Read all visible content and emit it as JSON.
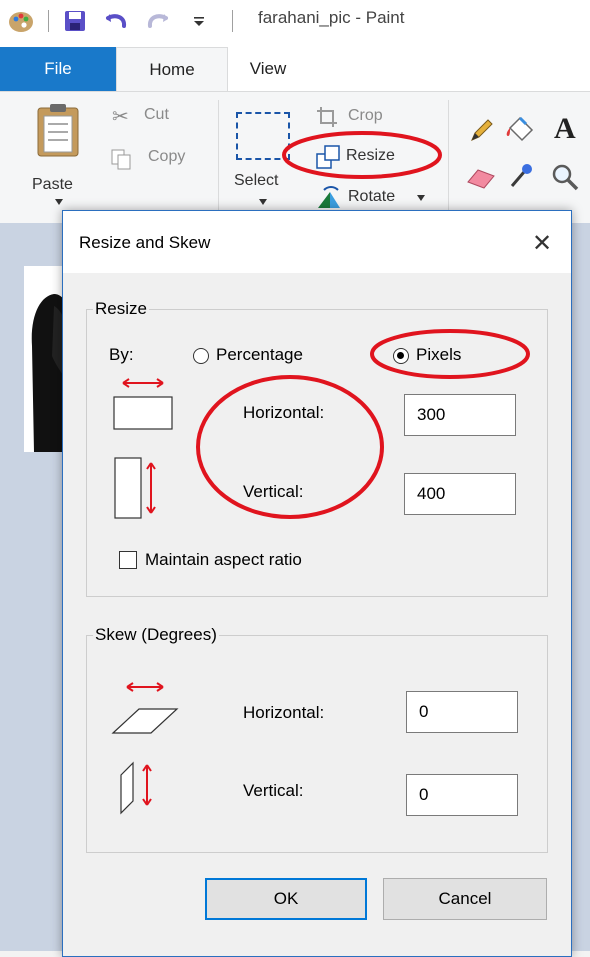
{
  "window": {
    "title": "farahani_pic - Paint"
  },
  "tabs": [
    {
      "label": "File",
      "active": false
    },
    {
      "label": "Home",
      "active": true
    },
    {
      "label": "View",
      "active": false
    }
  ],
  "ribbon": {
    "clipboard": {
      "paste": "Paste",
      "cut": "Cut",
      "copy": "Copy"
    },
    "image": {
      "select": "Select",
      "crop": "Crop",
      "resize": "Resize",
      "rotate": "Rotate"
    },
    "tools": {
      "text_glyph": "A"
    }
  },
  "dialog": {
    "title": "Resize and Skew",
    "close_glyph": "✕",
    "resize": {
      "legend": "Resize",
      "by_label": "By:",
      "options": [
        "Percentage",
        "Pixels"
      ],
      "selected": "Pixels",
      "horizontal_label": "Horizontal:",
      "horizontal_value": "300",
      "vertical_label": "Vertical:",
      "vertical_value": "400",
      "maintain_label": "Maintain aspect ratio",
      "maintain_checked": false
    },
    "skew": {
      "legend": "Skew (Degrees)",
      "horizontal_label": "Horizontal:",
      "horizontal_value": "0",
      "vertical_label": "Vertical:",
      "vertical_value": "0"
    },
    "ok": "OK",
    "cancel": "Cancel"
  },
  "colors": {
    "file_tab": "#1979ca",
    "annotation_red": "#e0141e",
    "icon_arrow_red": "#e0141e",
    "canvas_bg": "#c9d3e2"
  }
}
